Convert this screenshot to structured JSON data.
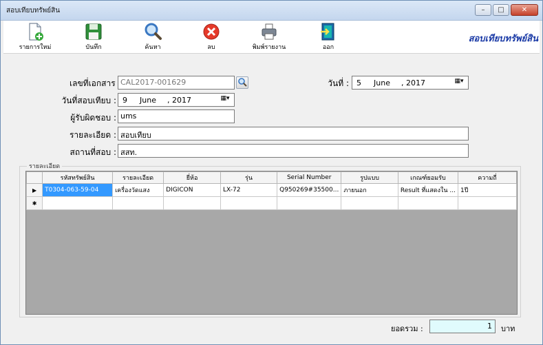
{
  "window": {
    "title": "สอบเทียบทรัพย์สิน"
  },
  "toolbar": {
    "new_label": "รายการใหม่",
    "save_label": "บันทึก",
    "search_label": "ค้นหา",
    "delete_label": "ลบ",
    "print_label": "พิมพ์รายงาน",
    "exit_label": "ออก",
    "brand": "สอบเทียบทรัพย์สิน"
  },
  "form": {
    "doc_no_label": "เลขที่เอกสาร :",
    "doc_no": "CAL2017-001629",
    "date_label": "วันที่ :",
    "date_day": "5",
    "date_month": "June",
    "date_year": ", 2017",
    "cal_date_label": "วันที่สอบเทียบ :",
    "cal_day": "9",
    "cal_month": "June",
    "cal_year": ", 2017",
    "resp_label": "ผู้รับผิดชอบ :",
    "resp": "ums",
    "detail_label": "รายละเอียด :",
    "detail": "สอบเทียบ",
    "place_label": "สถานที่สอบ :",
    "place": "สสท."
  },
  "grid": {
    "group_title": "รายละเอียด",
    "columns": [
      "รหัสทรัพย์สิน",
      "รายละเอียด",
      "ยี่ห้อ",
      "รุ่น",
      "Serial Number",
      "รูปแบบ",
      "เกณฑ์ยอมรับ",
      "ความถี่"
    ],
    "rows": [
      {
        "marker": "▶",
        "cells": [
          "T0304-063-59-04",
          "เครื่องวัดแสง",
          "DIGICON",
          "LX-72",
          "Q950269#35500...",
          "ภายนอก",
          "Result ที่แสดงใน ...",
          "1ปี"
        ]
      }
    ],
    "new_row_marker": "✱"
  },
  "footer": {
    "total_label": "ยอดรวม :",
    "total": "1",
    "unit": "บาท"
  }
}
